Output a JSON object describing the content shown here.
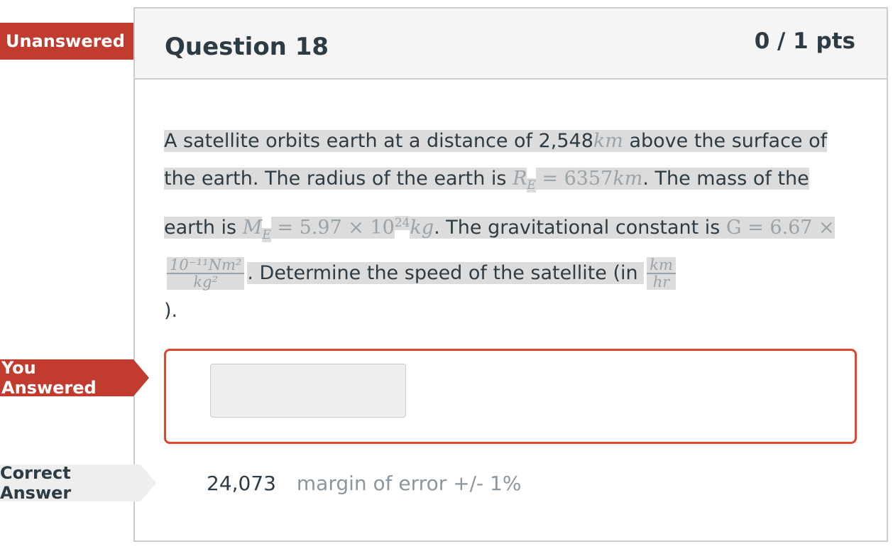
{
  "question": {
    "title": "Question 18",
    "points": "0 / 1 pts"
  },
  "flags": {
    "unanswered": "Unanswered",
    "you_answered": "You Answered",
    "correct_answer": "Correct Answer"
  },
  "question_text": {
    "t1": "A satellite orbits earth at  a distance of 2,548",
    "km1": "km",
    "t2": " above the surface of the earth. The radius of the earth is ",
    "re_sym": "R",
    "re_sub": "E",
    "re_val": " = 6357",
    "km2": "km",
    "t3": ".  The mass of the earth is ",
    "me_sym": "M",
    "me_sub": "E",
    "me_val": " = 5.97 × 10",
    "me_exp": "24",
    "kg": "kg",
    "t4": ".  The gravitational constant  is ",
    "g_eq": "G = 6.67 × ",
    "g_num": "10⁻¹¹Nm²",
    "g_den": "kg²",
    "t5": ".  Determine the speed of the satellite (in ",
    "unit_num": "km",
    "unit_den": "hr",
    "t6": ")."
  },
  "answer": {
    "input_value": ""
  },
  "correct": {
    "value": "24,073",
    "margin": "margin of error +/- 1%"
  }
}
